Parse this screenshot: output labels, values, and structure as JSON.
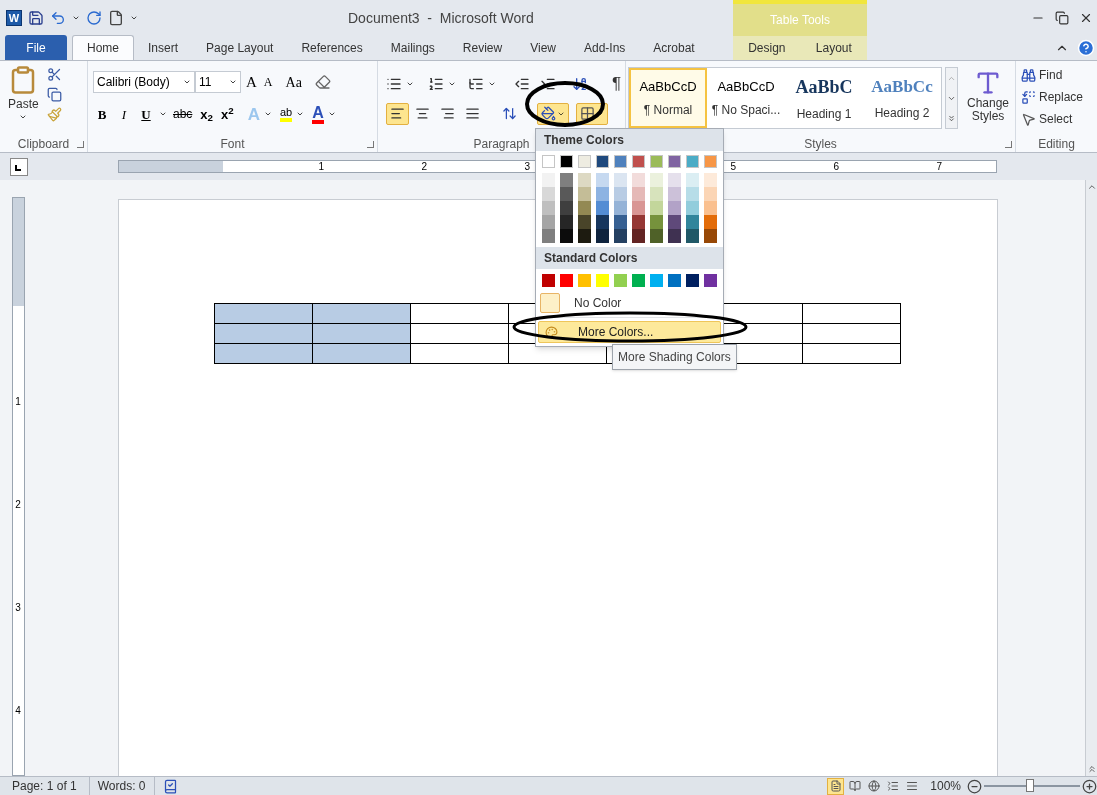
{
  "title_bar": {
    "app_letter": "W",
    "document_title": "Document3  -  Microsoft Word",
    "contextual_group": "Table Tools"
  },
  "tabs": [
    {
      "label": "File",
      "kind": "file",
      "selected": false
    },
    {
      "label": "Home",
      "kind": "normal",
      "selected": true
    },
    {
      "label": "Insert",
      "kind": "normal",
      "selected": false
    },
    {
      "label": "Page Layout",
      "kind": "normal",
      "selected": false
    },
    {
      "label": "References",
      "kind": "normal",
      "selected": false
    },
    {
      "label": "Mailings",
      "kind": "normal",
      "selected": false
    },
    {
      "label": "Review",
      "kind": "normal",
      "selected": false
    },
    {
      "label": "View",
      "kind": "normal",
      "selected": false
    },
    {
      "label": "Add-Ins",
      "kind": "normal",
      "selected": false
    },
    {
      "label": "Acrobat",
      "kind": "normal",
      "selected": false
    },
    {
      "label": "Design",
      "kind": "contextual",
      "selected": false
    },
    {
      "label": "Layout",
      "kind": "contextual",
      "selected": false
    }
  ],
  "ribbon": {
    "clipboard": {
      "label": "Clipboard",
      "paste": "Paste"
    },
    "font": {
      "label": "Font",
      "font_name": "Calibri (Body)",
      "font_size": "11",
      "grow": "A",
      "shrink": "A",
      "change_case": "Aa",
      "bold": "B",
      "italic": "I",
      "underline": "U",
      "strikethrough": "abc",
      "subscript": "x$_{2}$",
      "superscript": "x$^{2}$",
      "text_effects": "A",
      "highlight": "ab",
      "font_color": "A"
    },
    "paragraph": {
      "label": "Paragraph",
      "show_marks": "¶",
      "alignment": [
        {
          "kind": "left",
          "selected": true
        },
        {
          "kind": "center",
          "selected": false
        },
        {
          "kind": "right",
          "selected": false
        },
        {
          "kind": "justify",
          "selected": false
        }
      ],
      "shading_selected": true,
      "borders_selected": true
    },
    "styles": {
      "label": "Styles",
      "items": [
        {
          "preview": "AaBbCcD",
          "name": "¶ Normal",
          "kind": "body",
          "selected": true
        },
        {
          "preview": "AaBbCcD",
          "name": "¶ No Spaci...",
          "kind": "body",
          "selected": false
        },
        {
          "preview": "AaBbC",
          "name": "Heading 1",
          "kind": "heading1",
          "selected": false
        },
        {
          "preview": "AaBbCc",
          "name": "Heading 2",
          "kind": "heading2",
          "selected": false
        }
      ],
      "change_styles": "Change Styles"
    },
    "editing": {
      "label": "Editing",
      "find": "Find",
      "replace": "Replace",
      "select": "Select"
    }
  },
  "ruler": {
    "left_numbers": [
      "1",
      "2",
      "3"
    ],
    "right_numbers": [
      "5",
      "6",
      "7"
    ],
    "vertical_numbers": [
      "1",
      "2",
      "3",
      "4"
    ]
  },
  "table": {
    "rows": [
      {
        "cells": [
          {
            "shaded": true
          },
          {
            "shaded": true
          },
          {
            "shaded": false
          },
          {
            "shaded": false
          },
          {},
          {
            "shaded": false
          },
          {
            "shaded": false
          }
        ]
      },
      {
        "cells": [
          {
            "shaded": true
          },
          {
            "shaded": true
          },
          {
            "shaded": false
          },
          {
            "shaded": false
          },
          {},
          {
            "shaded": false
          },
          {
            "shaded": false
          }
        ]
      },
      {
        "cells": [
          {
            "shaded": true
          },
          {
            "shaded": true
          },
          {
            "shaded": false
          },
          {
            "shaded": false
          },
          {
            "shaded": false
          },
          {
            "shaded": false
          },
          {
            "shaded": false
          }
        ]
      }
    ]
  },
  "shading_menu": {
    "theme_label": "Theme Colors",
    "theme_columns": [
      {
        "color": "#ffffff",
        "shades": [
          {
            "color": "#f2f2f2"
          },
          {
            "color": "#d8d8d8"
          },
          {
            "color": "#bfbfbf"
          },
          {
            "color": "#a5a5a5"
          },
          {
            "color": "#7f7f7f"
          }
        ]
      },
      {
        "color": "#000000",
        "shades": [
          {
            "color": "#7f7f7f"
          },
          {
            "color": "#595959"
          },
          {
            "color": "#3f3f3f"
          },
          {
            "color": "#262626"
          },
          {
            "color": "#0c0c0c"
          }
        ]
      },
      {
        "color": "#eeece1",
        "shades": [
          {
            "color": "#ddd9c3"
          },
          {
            "color": "#c4bd97"
          },
          {
            "color": "#938953"
          },
          {
            "color": "#494429"
          },
          {
            "color": "#1d1b10"
          }
        ]
      },
      {
        "color": "#1f497d",
        "shades": [
          {
            "color": "#c6d9f0"
          },
          {
            "color": "#8db3e2"
          },
          {
            "color": "#548dd4"
          },
          {
            "color": "#17365d"
          },
          {
            "color": "#0f243e"
          }
        ]
      },
      {
        "color": "#4f81bd",
        "shades": [
          {
            "color": "#dbe5f1"
          },
          {
            "color": "#b8cce4"
          },
          {
            "color": "#95b3d7"
          },
          {
            "color": "#366092"
          },
          {
            "color": "#244061"
          }
        ]
      },
      {
        "color": "#c0504d",
        "shades": [
          {
            "color": "#f2dcdb"
          },
          {
            "color": "#e5b9b7"
          },
          {
            "color": "#d99694"
          },
          {
            "color": "#953734"
          },
          {
            "color": "#632423"
          }
        ]
      },
      {
        "color": "#9bbb59",
        "shades": [
          {
            "color": "#ebf1dd"
          },
          {
            "color": "#d7e3bc"
          },
          {
            "color": "#c3d69b"
          },
          {
            "color": "#76923c"
          },
          {
            "color": "#4f6128"
          }
        ]
      },
      {
        "color": "#8064a2",
        "shades": [
          {
            "color": "#e5e0ec"
          },
          {
            "color": "#ccc1d9"
          },
          {
            "color": "#b2a2c7"
          },
          {
            "color": "#5f497a"
          },
          {
            "color": "#3f3151"
          }
        ]
      },
      {
        "color": "#4bacc6",
        "shades": [
          {
            "color": "#dbeef3"
          },
          {
            "color": "#b7dde8"
          },
          {
            "color": "#92cddc"
          },
          {
            "color": "#31859b"
          },
          {
            "color": "#205867"
          }
        ]
      },
      {
        "color": "#f79646",
        "shades": [
          {
            "color": "#fdeada"
          },
          {
            "color": "#fbd5b5"
          },
          {
            "color": "#fac08f"
          },
          {
            "color": "#e36c09"
          },
          {
            "color": "#974806"
          }
        ]
      }
    ],
    "standard_label": "Standard Colors",
    "standard_colors": [
      {
        "color": "#c00000"
      },
      {
        "color": "#ff0000"
      },
      {
        "color": "#ffc000"
      },
      {
        "color": "#ffff00"
      },
      {
        "color": "#92d050"
      },
      {
        "color": "#00b050"
      },
      {
        "color": "#00b0f0"
      },
      {
        "color": "#0070c0"
      },
      {
        "color": "#002060"
      },
      {
        "color": "#7030a0"
      }
    ],
    "no_color": "No Color",
    "more_colors": "More Colors...",
    "tooltip": "More Shading Colors"
  },
  "status_bar": {
    "page": "Page: 1 of 1",
    "words": "Words: 0",
    "views": [
      {
        "kind": "print",
        "selected": true
      },
      {
        "kind": "reading",
        "selected": false
      },
      {
        "kind": "web",
        "selected": false
      },
      {
        "kind": "outline",
        "selected": false
      },
      {
        "kind": "draft",
        "selected": false
      }
    ],
    "zoom": "100%",
    "zoom_slider": {
      "level": 0.48
    }
  }
}
